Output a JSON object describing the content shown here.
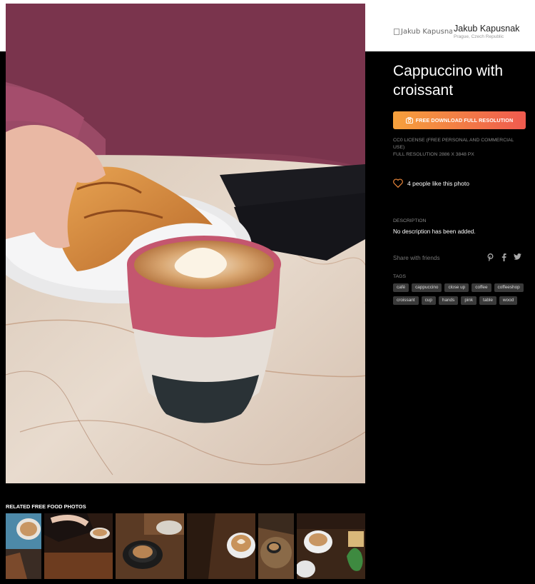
{
  "photo": {
    "title": "Cappuccino with croissant"
  },
  "author": {
    "image_alt": "Jakub Kapusnak",
    "name": "Jakub Kapusnak",
    "location": "Prague, Czech Republic"
  },
  "download": {
    "label": "FREE DOWNLOAD FULL RESOLUTION"
  },
  "license": {
    "line1": "CC0 LICENSE (FREE PERSONAL AND COMMERCIAL USE)",
    "line2": "FULL RESOLUTION 2886 X 3848 PX"
  },
  "likes": {
    "text": "4 people like this photo"
  },
  "description": {
    "label": "DESCRIPTION",
    "text": "No description has been added."
  },
  "share": {
    "label": "Share with friends",
    "icons": [
      "pinterest-icon",
      "facebook-icon",
      "twitter-icon"
    ]
  },
  "tags": {
    "label": "TAGS",
    "items": [
      "café",
      "cappuccino",
      "close up",
      "coffee",
      "coffeeshop",
      "croissant",
      "cup",
      "hands",
      "pink",
      "table",
      "wood"
    ]
  },
  "related": {
    "label": "RELATED FREE FOOD PHOTOS"
  },
  "colors": {
    "accent_start": "#f6a13c",
    "accent_end": "#ef5a4f",
    "background": "#000000"
  }
}
